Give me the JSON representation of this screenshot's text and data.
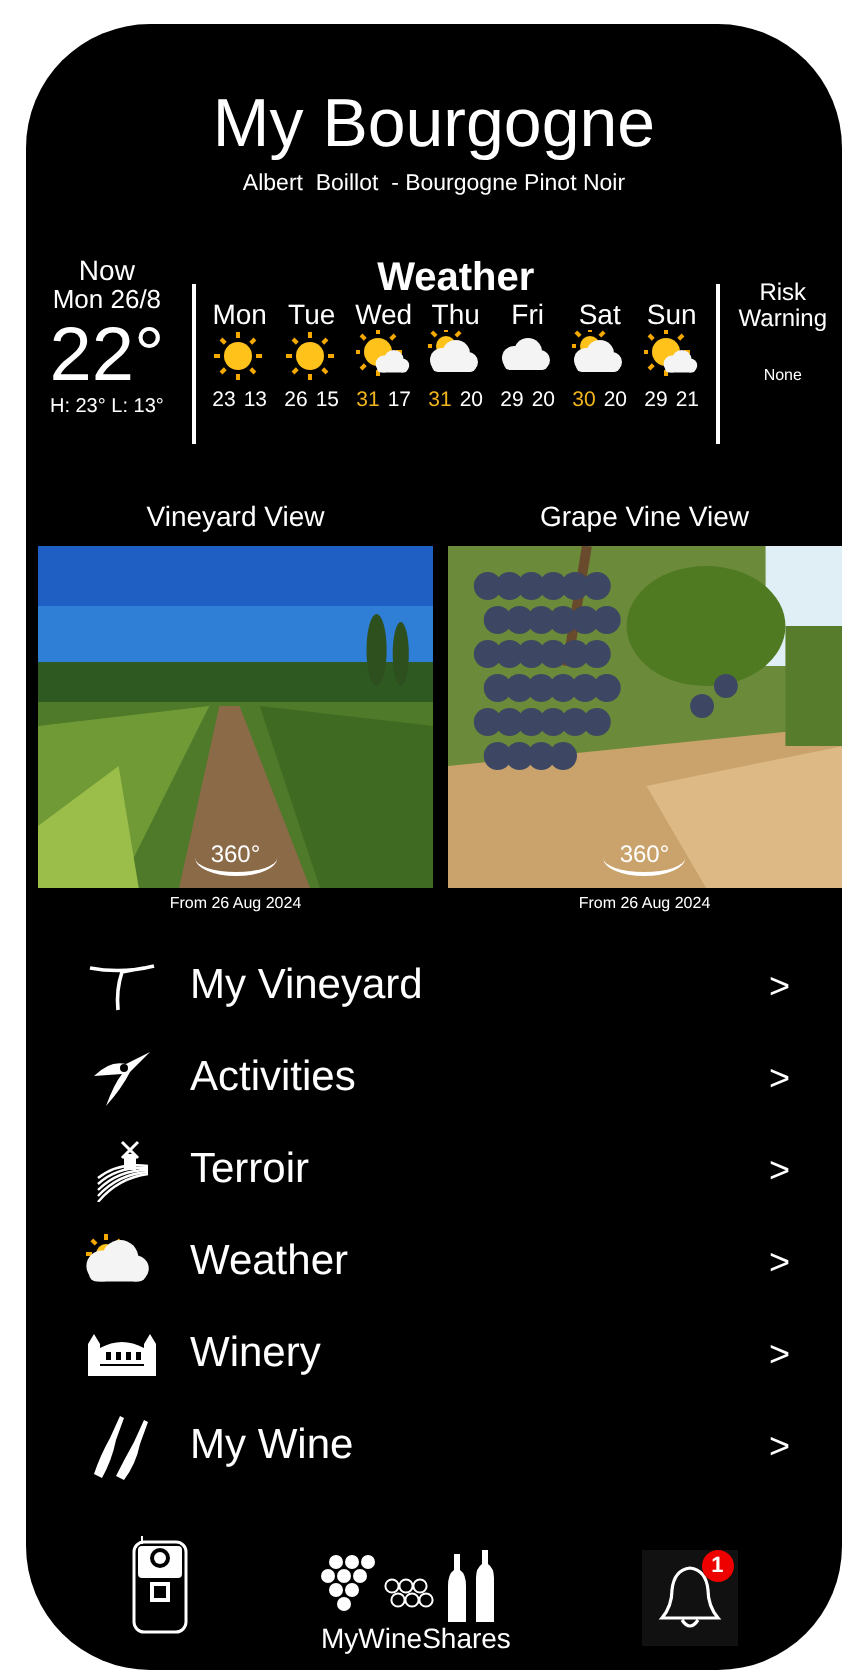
{
  "header": {
    "title": "My Bourgogne",
    "subtitle": "Albert  Boillot  - Bourgogne Pinot Noir"
  },
  "now": {
    "label": "Now",
    "date": "Mon 26/8",
    "temperature": "22°",
    "high_low": "H: 23° L: 13°"
  },
  "weather": {
    "title": "Weather",
    "days": [
      {
        "day": "Mon",
        "kind": "sunny",
        "high": "23",
        "low": "13",
        "hot": false
      },
      {
        "day": "Tue",
        "kind": "sunny",
        "high": "26",
        "low": "15",
        "hot": false
      },
      {
        "day": "Wed",
        "kind": "partlycloudy",
        "high": "31",
        "low": "17",
        "hot": true
      },
      {
        "day": "Thu",
        "kind": "mostlycloudy",
        "high": "31",
        "low": "20",
        "hot": true
      },
      {
        "day": "Fri",
        "kind": "cloudy",
        "high": "29",
        "low": "20",
        "hot": false
      },
      {
        "day": "Sat",
        "kind": "mostlycloudy",
        "high": "30",
        "low": "20",
        "hot": true
      },
      {
        "day": "Sun",
        "kind": "partlycloudy",
        "high": "29",
        "low": "21",
        "hot": false
      }
    ]
  },
  "risk": {
    "label": "Risk Warning",
    "value": "None"
  },
  "views": [
    {
      "title": "Vineyard View",
      "badge": "360°",
      "caption": "From 26 Aug 2024",
      "kind": "vineyard"
    },
    {
      "title": "Grape Vine View",
      "badge": "360°",
      "caption": "From 26 Aug 2024",
      "kind": "grapes"
    }
  ],
  "menu": [
    {
      "label": "My Vineyard",
      "chevron": ">"
    },
    {
      "label": "Activities",
      "chevron": ">"
    },
    {
      "label": "Terroir",
      "chevron": ">"
    },
    {
      "label": "Weather",
      "chevron": ">"
    },
    {
      "label": "Winery",
      "chevron": ">"
    },
    {
      "label": "My Wine",
      "chevron": ">"
    }
  ],
  "bottom_nav": {
    "brand": "MyWineShares",
    "notification_count": "1"
  }
}
